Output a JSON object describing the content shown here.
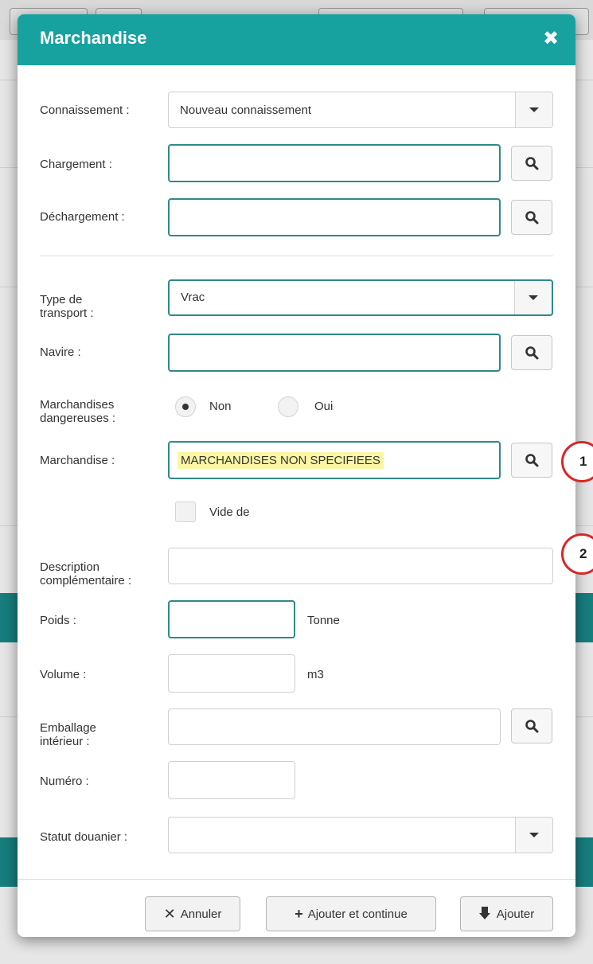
{
  "dialog": {
    "title": "Marchandise",
    "close_icon": "close-icon"
  },
  "form": {
    "connaissement": {
      "label": "Connaissement :",
      "value": "Nouveau connaissement"
    },
    "chargement": {
      "label": "Chargement :",
      "value": ""
    },
    "dechargement": {
      "label": "Déchargement :",
      "value": ""
    },
    "type_transport": {
      "label_line1": "Type de",
      "label_line2": "transport :",
      "value": "Vrac"
    },
    "navire": {
      "label": "Navire :",
      "value": ""
    },
    "dangereuses": {
      "label_line1": "Marchandises",
      "label_line2": "dangereuses :",
      "options": [
        "Non",
        "Oui"
      ],
      "selected": "Non"
    },
    "marchandise": {
      "label": "Marchandise :",
      "value": "MARCHANDISES NON SPECIFIEES"
    },
    "vide_de": {
      "label": "Vide de",
      "checked": false
    },
    "description": {
      "label_line1": "Description",
      "label_line2": "complémentaire :",
      "value": ""
    },
    "poids": {
      "label": "Poids :",
      "value": "",
      "unit": "Tonne"
    },
    "volume": {
      "label": "Volume :",
      "value": "",
      "unit": "m3"
    },
    "emballage": {
      "label_line1": "Emballage",
      "label_line2": "intérieur :",
      "value": ""
    },
    "numero": {
      "label": "Numéro :",
      "value": ""
    },
    "statut_douanier": {
      "label": "Statut douanier :",
      "value": ""
    }
  },
  "footer": {
    "cancel_label": "Annuler",
    "add_continue_label": "Ajouter et continue",
    "add_label": "Ajouter"
  },
  "annotations": [
    "1",
    "2"
  ],
  "colors": {
    "header": "#17a2a0",
    "focus_border": "#2f8a87",
    "highlight": "#fbf6a4",
    "annotation": "#d62828"
  }
}
